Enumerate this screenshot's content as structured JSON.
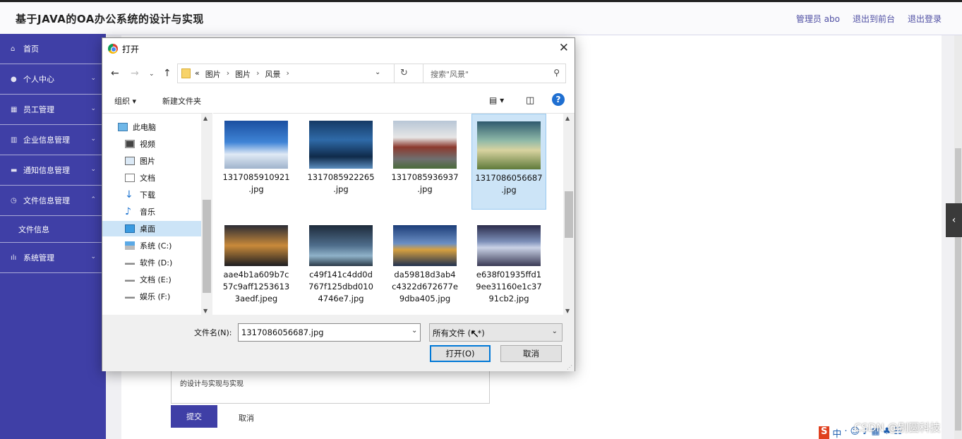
{
  "header": {
    "title": "基于JAVA的OA办公系统的设计与实现",
    "links": [
      "管理员 abo",
      "退出到前台",
      "退出登录"
    ]
  },
  "sidebar": {
    "items": [
      {
        "label": "首页",
        "icon": "home-icon"
      },
      {
        "label": "个人中心",
        "icon": "user-icon"
      },
      {
        "label": "员工管理",
        "icon": "grid-icon"
      },
      {
        "label": "企业信息管理",
        "icon": "bar-icon"
      },
      {
        "label": "通知信息管理",
        "icon": "monitor-icon"
      },
      {
        "label": "文件信息管理",
        "icon": "clock-icon"
      },
      {
        "label": "系统管理",
        "icon": "chart-icon"
      }
    ],
    "sub_item": "文件信息"
  },
  "form": {
    "content_text": "的设计与实现与实现",
    "submit_label": "提交",
    "cancel_label": "取消"
  },
  "watermark": "CSDN @别圆科技",
  "dialog": {
    "title": "打开",
    "breadcrumb": [
      "图片",
      "图片",
      "风景"
    ],
    "breadcrumb_prefix": "«",
    "search_placeholder": "搜索\"风景\"",
    "toolbar": {
      "organize": "组织 ▾",
      "new_folder": "新建文件夹"
    },
    "tree": [
      {
        "label": "此电脑",
        "icon": "pc-icon",
        "selected": false
      },
      {
        "label": "视频",
        "icon": "video-icon",
        "selected": false
      },
      {
        "label": "图片",
        "icon": "pictures-icon",
        "selected": false
      },
      {
        "label": "文档",
        "icon": "document-icon",
        "selected": false
      },
      {
        "label": "下载",
        "icon": "download-icon",
        "selected": false
      },
      {
        "label": "音乐",
        "icon": "music-icon",
        "selected": false
      },
      {
        "label": "桌面",
        "icon": "desktop-icon",
        "selected": true
      },
      {
        "label": "系统 (C:)",
        "icon": "drive-icon",
        "selected": false
      },
      {
        "label": "软件 (D:)",
        "icon": "drive-icon",
        "selected": false
      },
      {
        "label": "文档 (E:)",
        "icon": "drive-icon",
        "selected": false
      },
      {
        "label": "娱乐 (F:)",
        "icon": "drive-icon",
        "selected": false
      }
    ],
    "files": [
      {
        "name": "1317085910921.jpg",
        "line1": "1317085910921",
        "line2": ".jpg",
        "line3": "",
        "selected": false
      },
      {
        "name": "1317085922265.jpg",
        "line1": "1317085922265",
        "line2": ".jpg",
        "line3": "",
        "selected": false
      },
      {
        "name": "1317085936937.jpg",
        "line1": "1317085936937",
        "line2": ".jpg",
        "line3": "",
        "selected": false
      },
      {
        "name": "1317086056687.jpg",
        "line1": "1317086056687",
        "line2": ".jpg",
        "line3": "",
        "selected": true
      },
      {
        "name": "aae4b1a609b7c57c9aff12536133aedf.jpeg",
        "line1": "aae4b1a609b7c",
        "line2": "57c9aff1253613",
        "line3": "3aedf.jpeg",
        "selected": false
      },
      {
        "name": "c49f141c4dd0d767f125dbd0104746e7.jpg",
        "line1": "c49f141c4dd0d",
        "line2": "767f125dbd010",
        "line3": "4746e7.jpg",
        "selected": false
      },
      {
        "name": "da59818d3ab4c4322d672677e9dba405.jpg",
        "line1": "da59818d3ab4",
        "line2": "c4322d672677e",
        "line3": "9dba405.jpg",
        "selected": false
      },
      {
        "name": "e638f01935ffd19ee31160e1c3791cb2.jpg",
        "line1": "e638f01935ffd1",
        "line2": "9ee31160e1c37",
        "line3": "91cb2.jpg",
        "selected": false
      }
    ],
    "filename_label": "文件名(N):",
    "filename_value": "1317086056687.jpg",
    "filetype": "所有文件 (*.*)",
    "open_label": "打开(O)",
    "cancel_label": "取消"
  }
}
